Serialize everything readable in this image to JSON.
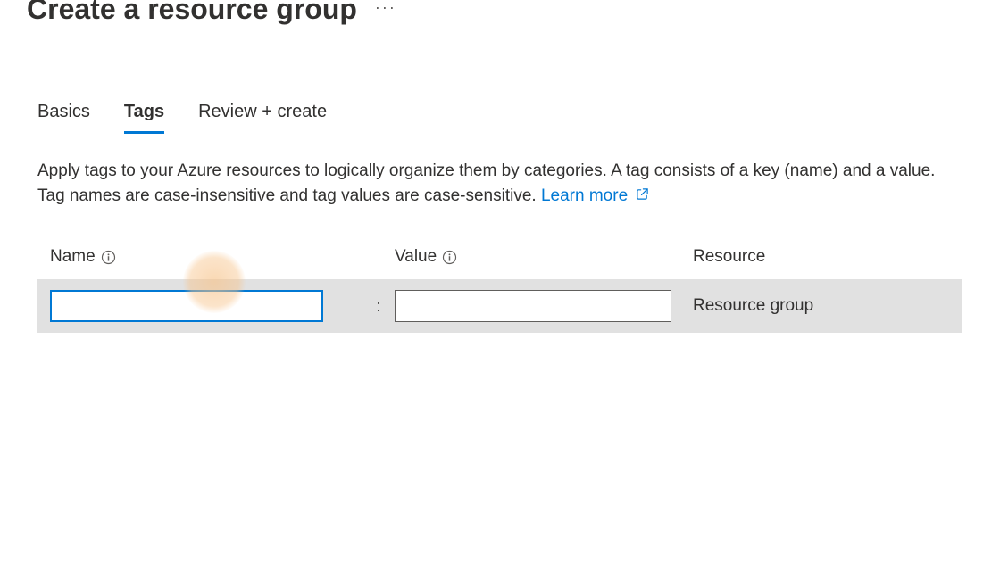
{
  "header": {
    "title": "Create a resource group",
    "more_icon_label": "more"
  },
  "tabs": [
    {
      "label": "Basics",
      "active": false
    },
    {
      "label": "Tags",
      "active": true
    },
    {
      "label": "Review + create",
      "active": false
    }
  ],
  "description": {
    "text": "Apply tags to your Azure resources to logically organize them by categories. A tag consists of a key (name) and a value. Tag names are case-insensitive and tag values are case-sensitive. ",
    "learn_more_label": "Learn more"
  },
  "tags_table": {
    "headers": {
      "name": "Name",
      "value": "Value",
      "resource": "Resource"
    },
    "row": {
      "name_value": "",
      "value_value": "",
      "separator": ":",
      "resource": "Resource group"
    }
  },
  "colors": {
    "accent": "#0078d4",
    "row_bg": "#e1e1e1"
  }
}
